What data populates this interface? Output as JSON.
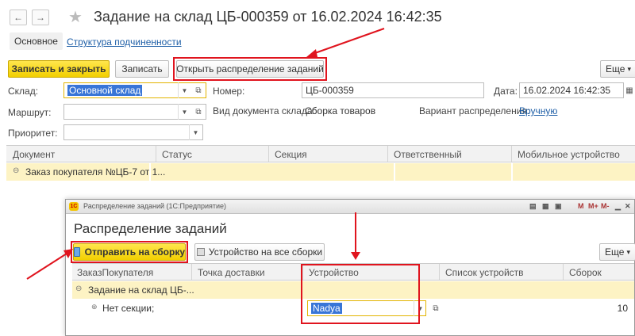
{
  "window": {
    "title": "Задание на склад ЦБ-000359 от 16.02.2024 16:42:35",
    "back_glyph": "←",
    "forward_glyph": "→",
    "star_glyph": "★"
  },
  "tabs": {
    "main": "Основное",
    "structure": "Структура подчиненности"
  },
  "toolbar": {
    "save_close": "Записать и закрыть",
    "save": "Записать",
    "open_distribution": "Открыть распределение заданий",
    "more": "Еще",
    "more_arrow": "▾"
  },
  "form": {
    "warehouse_label": "Склад:",
    "warehouse_value": "Основной склад",
    "number_label": "Номер:",
    "number_value": "ЦБ-000359",
    "date_label": "Дата:",
    "date_value": "16.02.2024 16:42:35",
    "route_label": "Маршрут:",
    "route_value": "",
    "doc_type_label": "Вид документа склада:",
    "doc_type_value": "Сборка товаров",
    "variant_label": "Вариант распределения:",
    "variant_value": "Вручную",
    "priority_label": "Приоритет:",
    "priority_value": ""
  },
  "main_table": {
    "columns": [
      "Документ",
      "Статус",
      "Секция",
      "Ответственный",
      "Мобильное устройство"
    ],
    "rows": [
      {
        "document": "Заказ покупателя №ЦБ-7 от 1..."
      }
    ]
  },
  "dialog": {
    "titlebar": "Распределение заданий (1С:Предприятие)",
    "heading": "Распределение заданий",
    "send_button": "Отправить на сборку",
    "device_all_button": "Устройство на все сборки",
    "more": "Еще",
    "more_arrow": "▾",
    "tb_icons": [
      "M",
      "M+",
      "M-"
    ],
    "columns": [
      "ЗаказПокупателя",
      "Точка доставки",
      "Устройство",
      "Список устройств",
      "Сборок"
    ],
    "group_row": "Задание на склад ЦБ-...",
    "detail_row": {
      "section": "Нет секции;",
      "device": "Nadya",
      "count": "10"
    }
  },
  "colors": {
    "accent_yellow": "#f2cf00",
    "annotation_red": "#e0141e",
    "link_blue": "#1f5fa7",
    "row_highlight": "#fdf3c4"
  }
}
